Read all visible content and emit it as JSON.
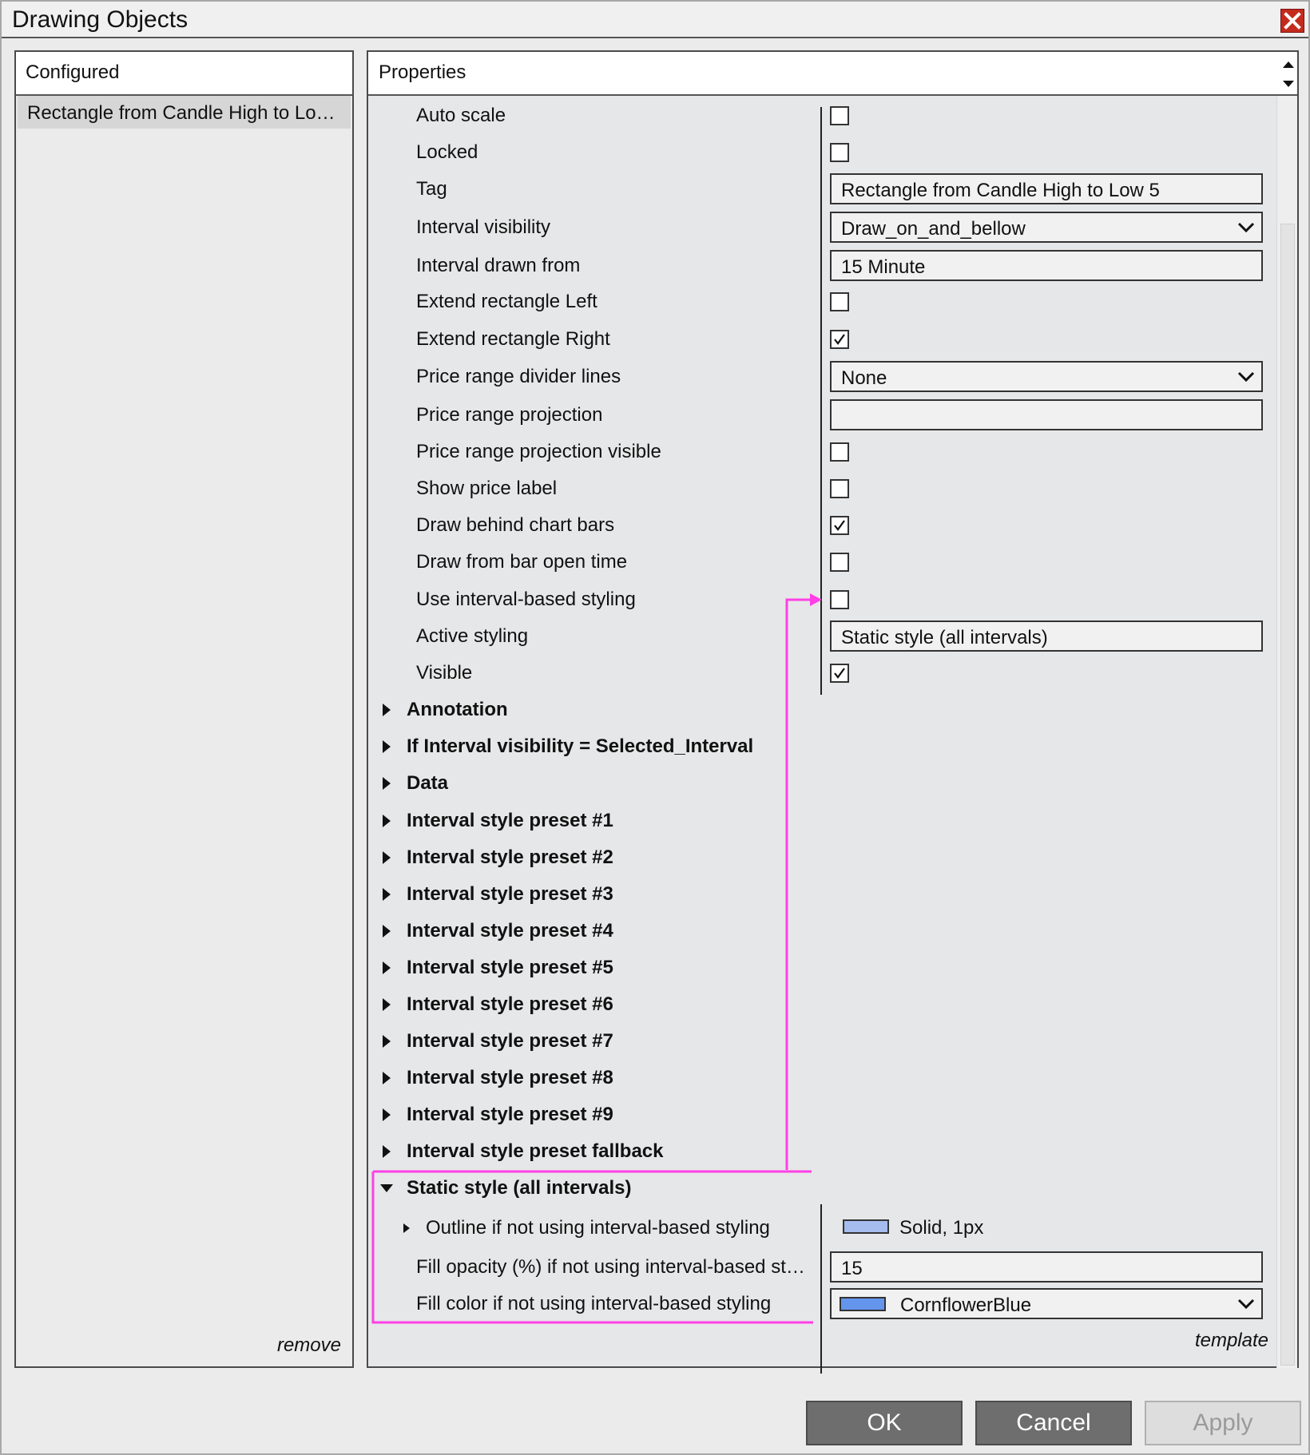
{
  "window": {
    "title": "Drawing Objects",
    "close_icon": "close-icon"
  },
  "configured": {
    "header": "Configured",
    "items": [
      "Rectangle from Candle High to Lo…"
    ],
    "remove_label": "remove"
  },
  "properties": {
    "header": "Properties",
    "template_label": "template",
    "rows": [
      {
        "label": "Auto scale",
        "type": "checkbox",
        "checked": false
      },
      {
        "label": "Locked",
        "type": "checkbox",
        "checked": false
      },
      {
        "label": "Tag",
        "type": "text",
        "value": "Rectangle from Candle High to Low 5"
      },
      {
        "label": "Interval visibility",
        "type": "select",
        "value": "Draw_on_and_bellow"
      },
      {
        "label": "Interval drawn from",
        "type": "text",
        "value": "15 Minute"
      },
      {
        "label": "Extend rectangle Left",
        "type": "checkbox",
        "checked": false
      },
      {
        "label": "Extend rectangle Right",
        "type": "checkbox",
        "checked": true
      },
      {
        "label": "Price range divider lines",
        "type": "select",
        "value": "None"
      },
      {
        "label": "Price range projection",
        "type": "text",
        "value": ""
      },
      {
        "label": "Price range projection visible",
        "type": "checkbox",
        "checked": false
      },
      {
        "label": "Show price label",
        "type": "checkbox",
        "checked": false
      },
      {
        "label": "Draw behind chart bars",
        "type": "checkbox",
        "checked": true
      },
      {
        "label": "Draw from bar open time",
        "type": "checkbox",
        "checked": false
      },
      {
        "label": "Use interval-based styling",
        "type": "checkbox",
        "checked": false
      },
      {
        "label": "Active styling",
        "type": "text",
        "value": "Static style (all intervals)"
      },
      {
        "label": "Visible",
        "type": "checkbox",
        "checked": true
      }
    ],
    "groups": [
      "Annotation",
      "If Interval visibility = Selected_Interval",
      "Data",
      "Interval style preset #1",
      "Interval style preset #2",
      "Interval style preset #3",
      "Interval style preset #4",
      "Interval style preset #5",
      "Interval style preset #6",
      "Interval style preset #7",
      "Interval style preset #8",
      "Interval style preset #9",
      "Interval style preset fallback"
    ],
    "static_group": {
      "label": "Static style (all intervals)",
      "outline_label": "Outline if not using interval-based styling",
      "outline_value": "Solid, 1px",
      "outline_color": "#a4bdee",
      "fill_opacity_label": "Fill opacity (%) if not using interval-based st…",
      "fill_opacity_value": "15",
      "fill_color_label": "Fill color if not using interval-based styling",
      "fill_color_value": "CornflowerBlue",
      "fill_color": "#6495ed"
    }
  },
  "buttons": {
    "ok": "OK",
    "cancel": "Cancel",
    "apply": "Apply"
  },
  "colors": {
    "annotation_magenta": "#ff3fe6",
    "close_red": "#c42b1c"
  }
}
